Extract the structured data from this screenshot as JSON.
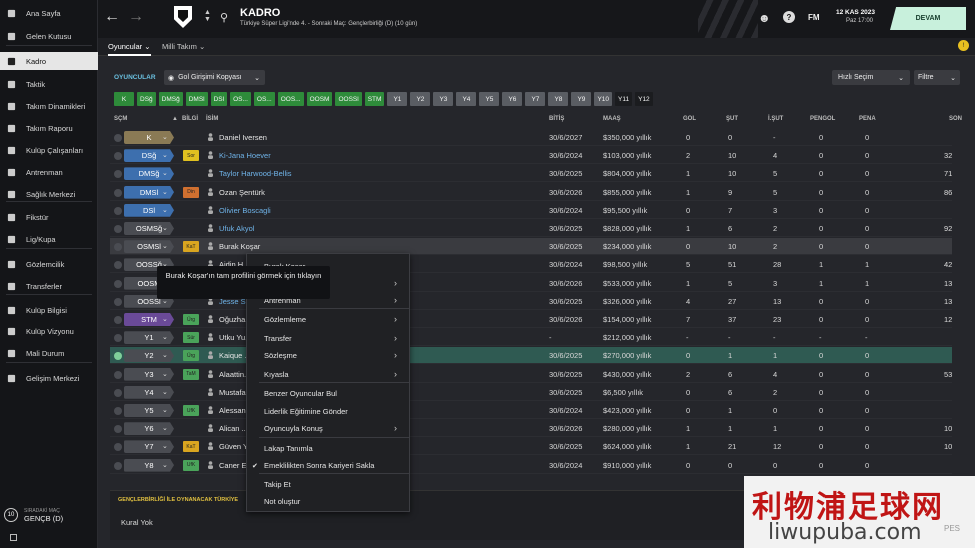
{
  "sidebar": {
    "items": [
      {
        "label": "Ana Sayfa",
        "icon": "home-icon"
      },
      {
        "label": "Gelen Kutusu",
        "icon": "inbox-icon"
      },
      {
        "label": "Kadro",
        "icon": "squad-icon",
        "active": true
      },
      {
        "label": "Taktik",
        "icon": "tactics-icon"
      },
      {
        "label": "Takım Dinamikleri",
        "icon": "dynamics-icon"
      },
      {
        "label": "Takım Raporu",
        "icon": "report-icon"
      },
      {
        "label": "Kulüp Çalışanları",
        "icon": "staff-icon"
      },
      {
        "label": "Antrenman",
        "icon": "training-icon"
      },
      {
        "label": "Sağlık Merkezi",
        "icon": "medical-icon"
      },
      {
        "label": "Fikstür",
        "icon": "calendar-icon"
      },
      {
        "label": "Lig/Kupa",
        "icon": "trophy-icon"
      },
      {
        "label": "Gözlemcilik",
        "icon": "scouting-icon"
      },
      {
        "label": "Transferler",
        "icon": "transfer-icon"
      },
      {
        "label": "Kulüp Bilgisi",
        "icon": "club-info-icon"
      },
      {
        "label": "Kulüp Vizyonu",
        "icon": "vision-icon"
      },
      {
        "label": "Mali Durum",
        "icon": "finance-icon"
      },
      {
        "label": "Gelişim Merkezi",
        "icon": "development-icon"
      }
    ],
    "next_match_label": "SIRADAKİ MAÇ",
    "next_match_team": "GENÇB (D)",
    "next_match_days": "10"
  },
  "topbar": {
    "title": "KADRO",
    "subtitle": "Türkiye Süper Ligi'nde 4. - Sonraki Maç: Gençlerbirliği (D) (10 gün)",
    "date": "12 KAS 2023",
    "time": "Paz 17:00",
    "continue": "DEVAM",
    "fm_label": "FM"
  },
  "subnav": {
    "tabs": [
      "Oyuncular",
      "Milli Takım"
    ]
  },
  "filters": {
    "section_label": "OYUNCULAR",
    "view_select": "Gol Girişimi Kopyası",
    "quick_pick": "Hızlı Seçim",
    "filter": "Filtre",
    "positions_green": [
      "K",
      "DSğ",
      "DMSğ",
      "DMSl",
      "DSl",
      "OS...",
      "OS...",
      "OOS...",
      "OOSM",
      "OOSSl",
      "STM"
    ],
    "positions_grey": [
      "Y1",
      "Y2",
      "Y3",
      "Y4",
      "Y5",
      "Y6",
      "Y7",
      "Y8",
      "Y9",
      "Y10"
    ],
    "positions_dark": [
      "Y11",
      "Y12"
    ]
  },
  "table": {
    "headers": {
      "pos": "SÇM",
      "info": "BİLGİ",
      "name": "İSİM",
      "end": "BİTİŞ",
      "wage": "MAAŞ",
      "goals": "GOL",
      "shots": "ŞUT",
      "on_target": "İ.ŞUT",
      "pen_goals": "PENGOL",
      "pens": "PENA",
      "last": "SON"
    },
    "rows": [
      {
        "pos": "K",
        "posColor": "#8a7a55",
        "badge": "",
        "badgeColor": "",
        "name": "Daniel Iversen",
        "nameBlue": false,
        "end": "30/6/2027",
        "wage": "$350,000 yıllık",
        "g": "0",
        "s": "0",
        "t": "-",
        "pg": "0",
        "p": "0",
        "l": ""
      },
      {
        "pos": "DSğ",
        "posColor": "#3d6fae",
        "badge": "Sor",
        "badgeColor": "#e0c020",
        "name": "Ki-Jana Hoever",
        "nameBlue": true,
        "end": "30/6/2024",
        "wage": "$103,000 yıllık",
        "g": "2",
        "s": "10",
        "t": "4",
        "pg": "0",
        "p": "0",
        "l": "32"
      },
      {
        "pos": "DMSğ",
        "posColor": "#3d6fae",
        "badge": "",
        "badgeColor": "",
        "name": "Taylor Harwood-Bellis",
        "nameBlue": true,
        "end": "30/6/2025",
        "wage": "$804,000 yıllık",
        "g": "1",
        "s": "10",
        "t": "5",
        "pg": "0",
        "p": "0",
        "l": "71"
      },
      {
        "pos": "DMSl",
        "posColor": "#3d6fae",
        "badge": "Din",
        "badgeColor": "#d07030",
        "name": "Ozan Şentürk",
        "nameBlue": false,
        "end": "30/6/2026",
        "wage": "$855,000 yıllık",
        "g": "1",
        "s": "9",
        "t": "5",
        "pg": "0",
        "p": "0",
        "l": "86"
      },
      {
        "pos": "DSl",
        "posColor": "#3d6fae",
        "badge": "",
        "badgeColor": "",
        "name": "Olivier Boscagli",
        "nameBlue": true,
        "end": "30/6/2024",
        "wage": "$95,500 yıllık",
        "g": "0",
        "s": "7",
        "t": "3",
        "pg": "0",
        "p": "0",
        "l": ""
      },
      {
        "pos": "OSMSğ",
        "posColor": "#4a4c52",
        "badge": "",
        "badgeColor": "",
        "name": "Ufuk Akyol",
        "nameBlue": true,
        "end": "30/6/2025",
        "wage": "$828,000 yıllık",
        "g": "1",
        "s": "6",
        "t": "2",
        "pg": "0",
        "p": "0",
        "l": "92"
      },
      {
        "pos": "OSMSl",
        "posColor": "#4a4c52",
        "badge": "KaT",
        "badgeColor": "#d9a520",
        "name": "Burak Koşar",
        "nameBlue": false,
        "end": "30/6/2025",
        "wage": "$234,000 yıllık",
        "g": "0",
        "s": "10",
        "t": "2",
        "pg": "0",
        "p": "0",
        "l": ""
      },
      {
        "pos": "OOSSğ",
        "posColor": "#4a4c52",
        "badge": "",
        "badgeColor": "",
        "name": "Aidin H...",
        "nameBlue": false,
        "end": "30/6/2024",
        "wage": "$98,500 yıllık",
        "g": "5",
        "s": "51",
        "t": "28",
        "pg": "1",
        "p": "1",
        "l": "42"
      },
      {
        "pos": "OOSM",
        "posColor": "#4a4c52",
        "badge": "",
        "badgeColor": "",
        "name": "",
        "nameBlue": false,
        "end": "30/6/2026",
        "wage": "$533,000 yıllık",
        "g": "1",
        "s": "5",
        "t": "3",
        "pg": "1",
        "p": "1",
        "l": "13"
      },
      {
        "pos": "OOSSl",
        "posColor": "#4a4c52",
        "badge": "",
        "badgeColor": "",
        "name": "Jesse S...",
        "nameBlue": true,
        "end": "30/6/2025",
        "wage": "$326,000 yıllık",
        "g": "4",
        "s": "27",
        "t": "13",
        "pg": "0",
        "p": "0",
        "l": "13"
      },
      {
        "pos": "STM",
        "posColor": "#6a4a98",
        "badge": "Ürg",
        "badgeColor": "#4aa35a",
        "name": "Oğuzha...",
        "nameBlue": false,
        "end": "30/6/2026",
        "wage": "$154,000 yıllık",
        "g": "7",
        "s": "37",
        "t": "23",
        "pg": "0",
        "p": "0",
        "l": "12"
      },
      {
        "pos": "Y1",
        "posColor": "#4a4c52",
        "badge": "Sür",
        "badgeColor": "#4aa35a",
        "name": "Utku Yu...",
        "nameBlue": false,
        "end": "-",
        "wage": "$212,000 yıllık",
        "g": "-",
        "s": "-",
        "t": "-",
        "pg": "-",
        "p": "-",
        "l": ""
      },
      {
        "pos": "Y2",
        "posColor": "#4a4c52",
        "badge": "Ürg",
        "badgeColor": "#4aa35a",
        "name": "Kaique ...",
        "nameBlue": false,
        "end": "30/6/2025",
        "wage": "$270,000 yıllık",
        "g": "0",
        "s": "1",
        "t": "1",
        "pg": "0",
        "p": "0",
        "l": ""
      },
      {
        "pos": "Y3",
        "posColor": "#4a4c52",
        "badge": "TaM",
        "badgeColor": "#4aa35a",
        "name": "Alaattin...",
        "nameBlue": false,
        "end": "30/6/2025",
        "wage": "$430,000 yıllık",
        "g": "2",
        "s": "6",
        "t": "4",
        "pg": "0",
        "p": "0",
        "l": "53"
      },
      {
        "pos": "Y4",
        "posColor": "#4a4c52",
        "badge": "",
        "badgeColor": "",
        "name": "Mustafa...",
        "nameBlue": false,
        "end": "30/6/2025",
        "wage": "$6,500 yıllık",
        "g": "0",
        "s": "6",
        "t": "2",
        "pg": "0",
        "p": "0",
        "l": ""
      },
      {
        "pos": "Y5",
        "posColor": "#4a4c52",
        "badge": "UfK",
        "badgeColor": "#4aa35a",
        "name": "Alessan...",
        "nameBlue": false,
        "end": "30/6/2024",
        "wage": "$423,000 yıllık",
        "g": "0",
        "s": "1",
        "t": "0",
        "pg": "0",
        "p": "0",
        "l": ""
      },
      {
        "pos": "Y6",
        "posColor": "#4a4c52",
        "badge": "",
        "badgeColor": "",
        "name": "Alican ...",
        "nameBlue": false,
        "end": "30/6/2026",
        "wage": "$280,000 yıllık",
        "g": "1",
        "s": "1",
        "t": "1",
        "pg": "0",
        "p": "0",
        "l": "10"
      },
      {
        "pos": "Y7",
        "posColor": "#4a4c52",
        "badge": "KaT",
        "badgeColor": "#d9a520",
        "name": "Güven Y...",
        "nameBlue": false,
        "end": "30/6/2025",
        "wage": "$624,000 yıllık",
        "g": "1",
        "s": "21",
        "t": "12",
        "pg": "0",
        "p": "0",
        "l": "10"
      },
      {
        "pos": "Y8",
        "posColor": "#4a4c52",
        "badge": "UfK",
        "badgeColor": "#4aa35a",
        "name": "Caner E...",
        "nameBlue": false,
        "end": "30/6/2024",
        "wage": "$910,000 yıllık",
        "g": "0",
        "s": "0",
        "t": "0",
        "pg": "0",
        "p": "0",
        "l": ""
      }
    ]
  },
  "bottom": {
    "label": "GENÇLERBİRLİĞİ İLE OYNANACAK TÜRKİYE",
    "rules": "Kural Yok"
  },
  "tooltip": "Burak Koşar'ın tam profilini görmek için tıklayın",
  "context_menu": {
    "items": [
      {
        "label": "Burak Koşar",
        "arrow": false
      },
      {
        "label": "",
        "arrow": true
      },
      {
        "label": "Antrenman",
        "arrow": true
      },
      {
        "label": "Gözlemleme",
        "arrow": true
      },
      {
        "label": "Transfer",
        "arrow": true
      },
      {
        "label": "Sözleşme",
        "arrow": true
      },
      {
        "label": "Kıyasla",
        "arrow": true
      },
      {
        "label": "Benzer Oyuncular Bul",
        "arrow": false
      },
      {
        "label": "Liderlik Eğitimine Gönder",
        "arrow": false
      },
      {
        "label": "Oyuncuyla Konuş",
        "arrow": true
      },
      {
        "label": "Lakap Tanımla",
        "arrow": false
      },
      {
        "label": "Emeklilikten Sonra Kariyeri Sakla",
        "arrow": false,
        "checked": true
      },
      {
        "label": "Takip Et",
        "arrow": false
      },
      {
        "label": "Not oluştur",
        "arrow": false
      }
    ]
  },
  "watermark": {
    "cn": "利物浦足球网",
    "url": "liwupuba.com",
    "side": "PES"
  },
  "colors": {
    "accent": "#2e8b3a",
    "continue_btn": "#c8f0dc",
    "selected_row": "#2f5a52"
  }
}
